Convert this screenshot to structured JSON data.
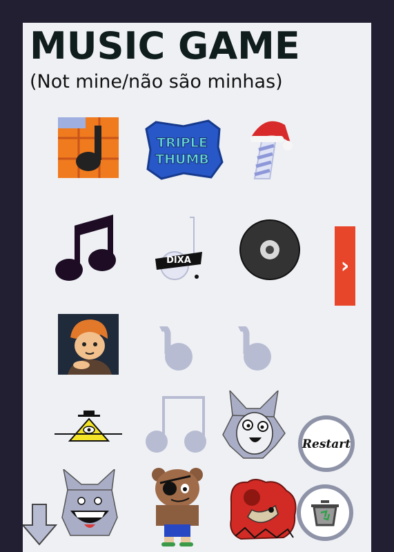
{
  "title": "MUSIC GAME",
  "subtitle": "(Not mine/não são minhas)",
  "characters": {
    "row1": [
      "orange-grid-note-icon",
      "triple-thumb-logo",
      "santa-hat-note-icon"
    ],
    "row2": [
      "black-double-note-icon",
      "graffiti-note-icon",
      "vinyl-record-icon"
    ],
    "row3": [
      "redhead-boy-portrait",
      "ghost-note-icon",
      "ghost-note-icon"
    ],
    "row4": [
      "illuminati-triangle-icon",
      "ghost-double-note-icon",
      "grey-cat-character"
    ],
    "row5": [
      "grinning-cat-character",
      "eyepatch-bear-character",
      "red-monster-character"
    ]
  },
  "triple_thumb_text": "TRIPLE THUMB",
  "graffiti_text": "DIXA",
  "restart_label": "Restart",
  "next_glyph": "›",
  "colors": {
    "background": "#231f33",
    "panel": "#eef0f4",
    "next": "#e8462a",
    "ghost": "#b8bcd2"
  }
}
